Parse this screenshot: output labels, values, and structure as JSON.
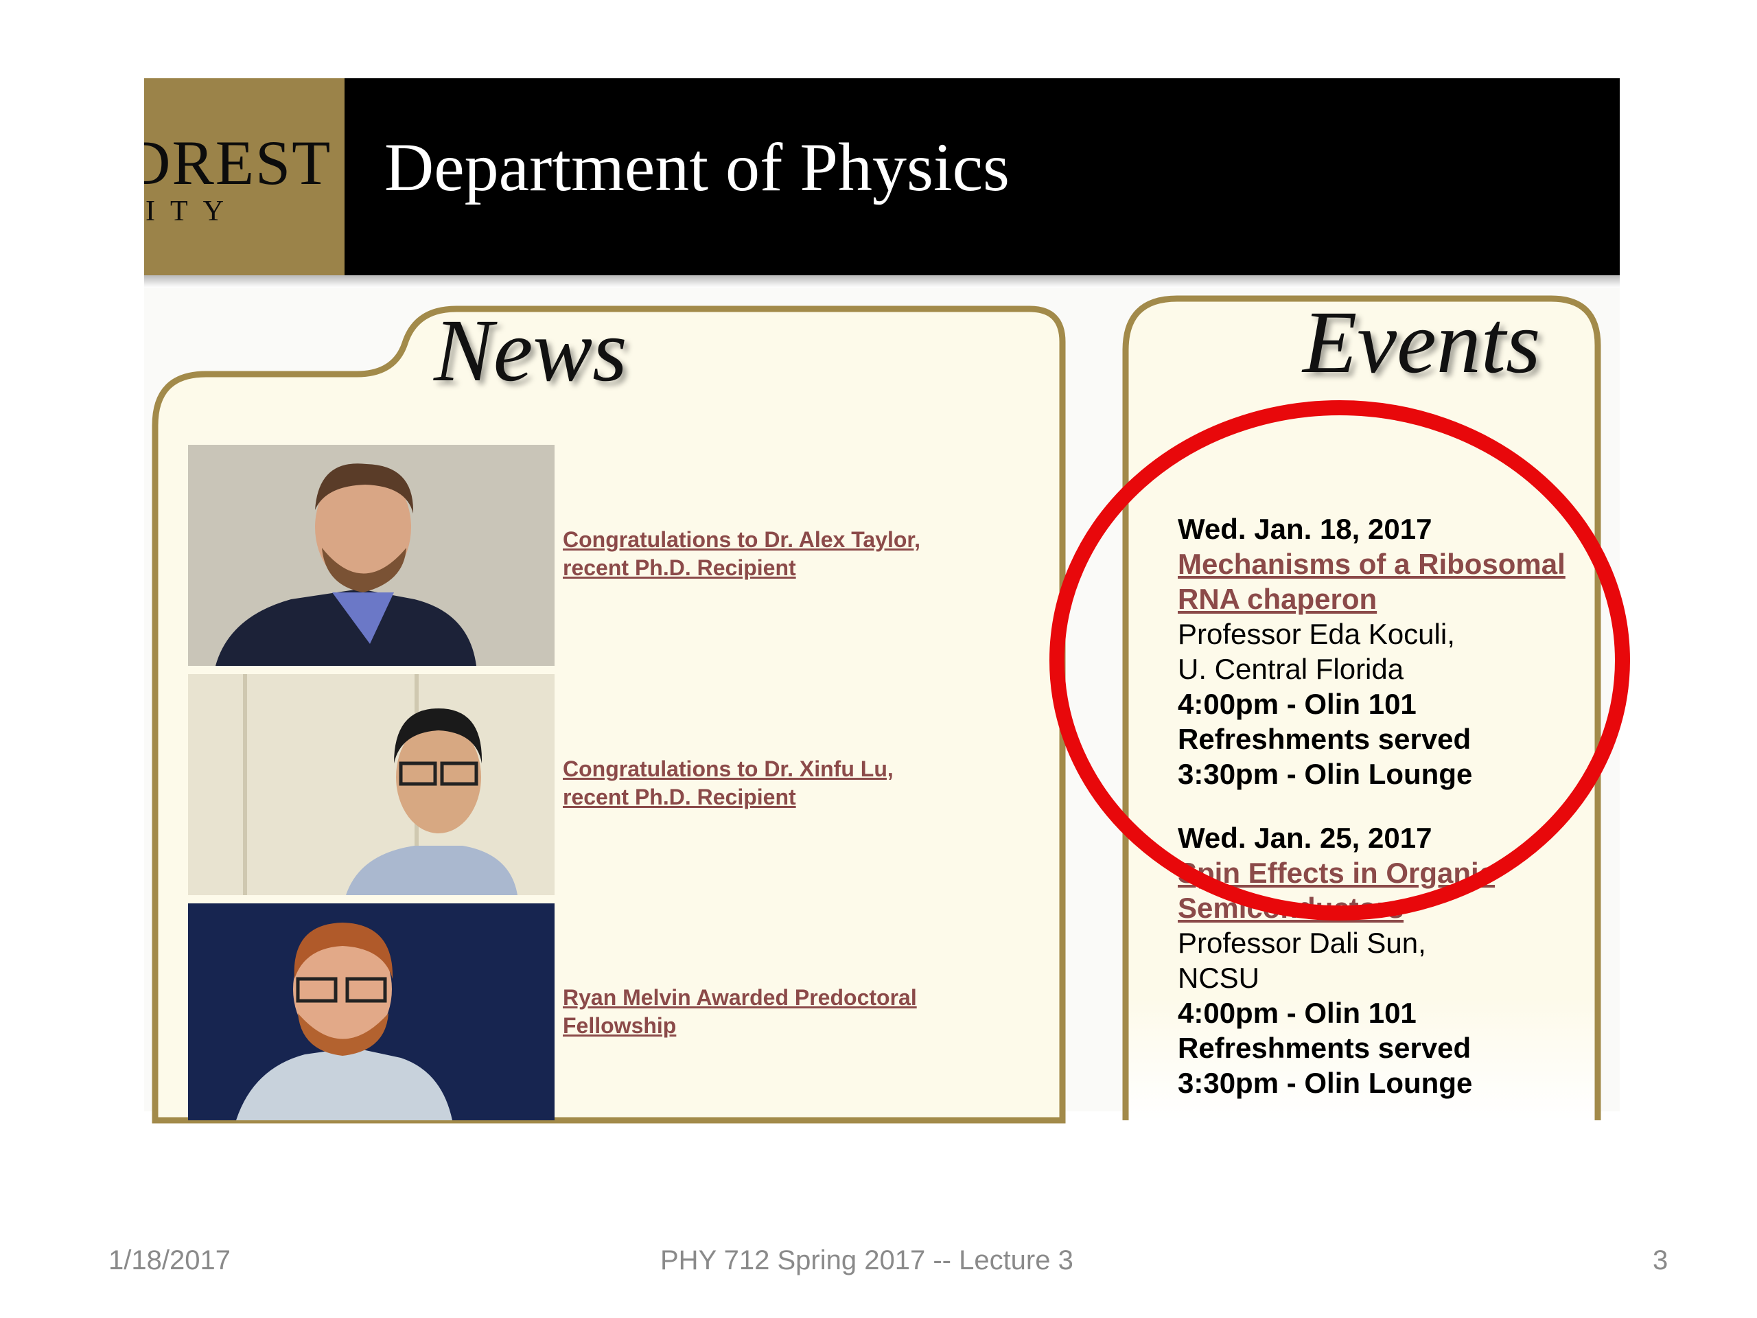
{
  "banner": {
    "logo_word": "DREST",
    "logo_sub": "ITY",
    "title": "Department of Physics"
  },
  "news": {
    "heading": "News",
    "items": [
      {
        "link": "Congratulations to Dr. Alex Taylor, recent Ph.D. Recipient"
      },
      {
        "link": "Congratulations to Dr. Xinfu Lu, recent Ph.D. Recipient"
      },
      {
        "link": "Ryan Melvin Awarded Predoctoral Fellowship"
      }
    ]
  },
  "events": {
    "heading": "Events",
    "items": [
      {
        "date": "Wed. Jan. 18, 2017",
        "title": "Mechanisms of a Ribosomal RNA chaperon",
        "speaker": "Professor Eda Koculi,",
        "affiliation": "U. Central Florida",
        "time": "4:00pm - Olin 101",
        "refreshments": "Refreshments served",
        "refreshments_time": "3:30pm - Olin Lounge"
      },
      {
        "date": "Wed. Jan. 25, 2017",
        "title": "Spin Effects in Organic Semiconductors",
        "speaker": "Professor Dali Sun,",
        "affiliation": "NCSU",
        "time": "4:00pm - Olin 101",
        "refreshments": "Refreshments served",
        "refreshments_time": "3:30pm - Olin Lounge"
      }
    ]
  },
  "highlight": {
    "color": "#e8080b"
  },
  "footer": {
    "date": "1/18/2017",
    "course": "PHY 712  Spring 2017 -- Lecture 3",
    "page": "3"
  },
  "colors": {
    "link": "#8b4a49",
    "gold": "#9b8349",
    "panel_border": "#a28a4a",
    "panel_fill": "#fdfaea"
  }
}
